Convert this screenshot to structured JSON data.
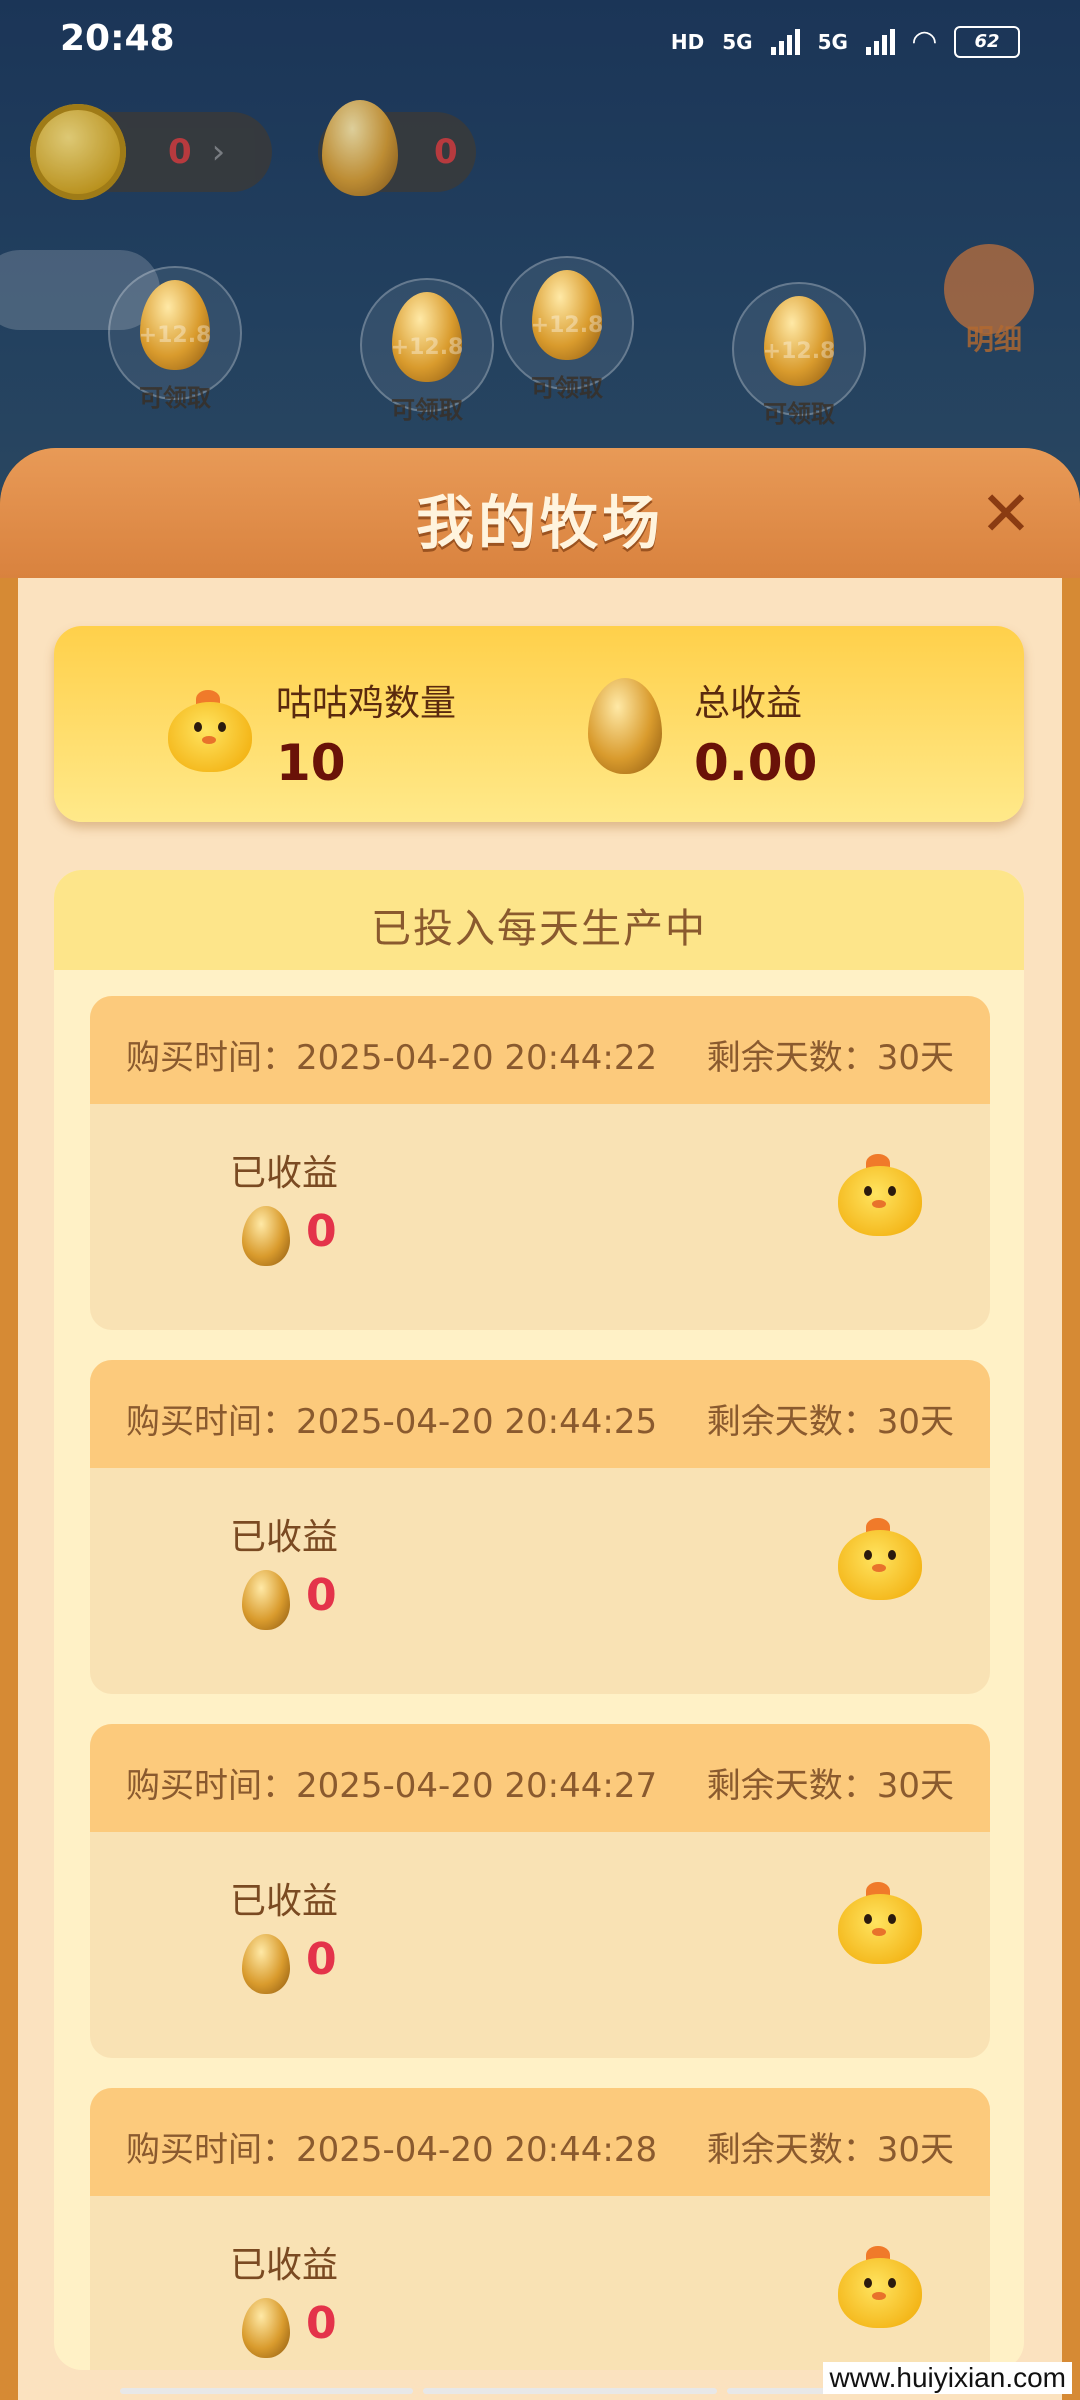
{
  "status_bar": {
    "time": "20:48",
    "network": "5G",
    "battery": "62"
  },
  "game": {
    "coin_count": "0",
    "egg_count": "0",
    "bubble_bonus": "+12.8",
    "bubble_claim": "可领取",
    "detail_label": "明细"
  },
  "modal": {
    "title": "我的牧场",
    "close": "✕",
    "summary": {
      "chicken_label": "咕咕鸡数量",
      "chicken_value": "10",
      "income_label": "总收益",
      "income_value": "0.00"
    },
    "production_title": "已投入每天生产中",
    "orders": [
      {
        "time": "购买时间：2025-04-20 20:44:22",
        "days": "剩余天数：30天",
        "earned_label": "已收益",
        "earned_value": "0"
      },
      {
        "time": "购买时间：2025-04-20 20:44:25",
        "days": "剩余天数：30天",
        "earned_label": "已收益",
        "earned_value": "0"
      },
      {
        "time": "购买时间：2025-04-20 20:44:27",
        "days": "剩余天数：30天",
        "earned_label": "已收益",
        "earned_value": "0"
      },
      {
        "time": "购买时间：2025-04-20 20:44:28",
        "days": "剩余天数：30天",
        "earned_label": "已收益",
        "earned_value": "0"
      }
    ]
  },
  "watermark": "www.huiyixian.com"
}
